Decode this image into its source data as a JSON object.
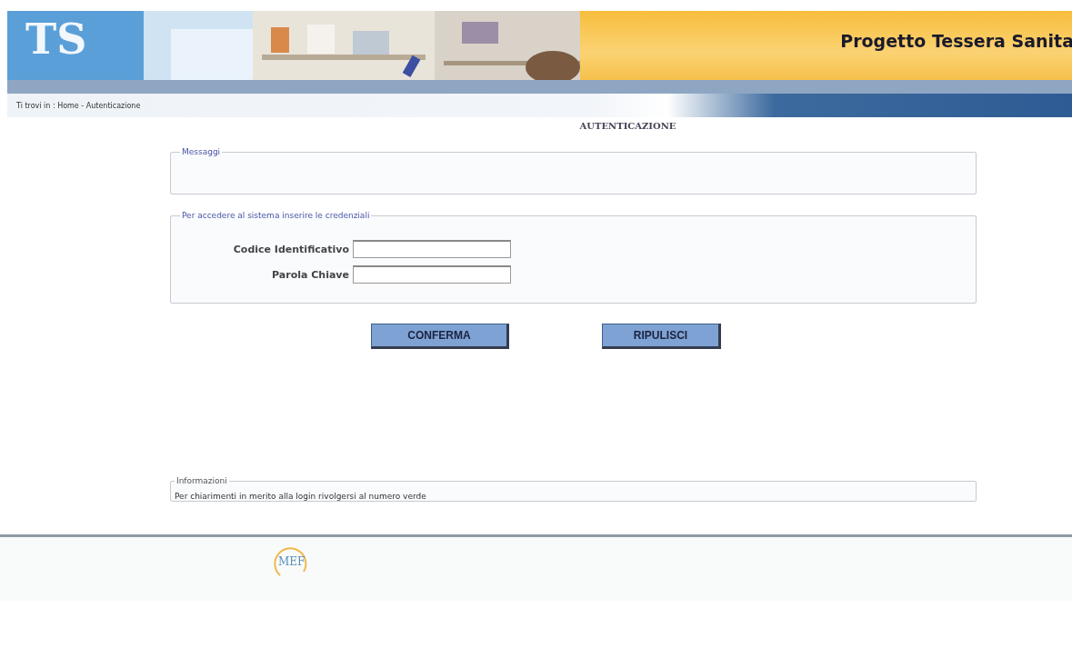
{
  "header": {
    "logo": "TS",
    "title": "Progetto Tessera Sanita"
  },
  "breadcrumb": "Ti trovi in : Home - Autenticazione",
  "page_title": "AUTENTICAZIONE",
  "message_box": {
    "legend": "Messaggi"
  },
  "login_box": {
    "legend": "Per accedere al sistema inserire le credenziali",
    "fields": [
      {
        "label": "Codice Identificativo"
      },
      {
        "label": "Parola Chiave"
      }
    ]
  },
  "buttons": [
    "CONFERMA",
    "RIPULISCI"
  ],
  "info_box": {
    "legend": "Informazioni",
    "text": "Per chiarimenti in merito alla login rivolgersi al numero verde"
  },
  "footer": {
    "logo": "MEF"
  }
}
